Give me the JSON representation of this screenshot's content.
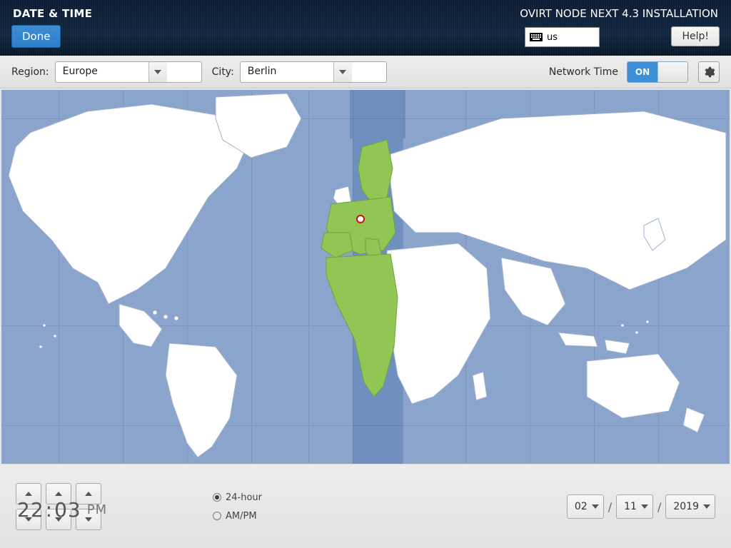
{
  "header": {
    "title": "DATE & TIME",
    "done_label": "Done",
    "installer_title": "OVIRT NODE NEXT 4.3 INSTALLATION",
    "keyboard_layout": "us",
    "help_label": "Help!"
  },
  "topbar": {
    "region_label": "Region:",
    "region_value": "Europe",
    "city_label": "City:",
    "city_value": "Berlin",
    "network_time_label": "Network Time",
    "network_time_on": "ON",
    "network_time_state": true
  },
  "map": {
    "selected_city": "Berlin",
    "selected_region": "Europe"
  },
  "time": {
    "hours": "22",
    "minutes": "03",
    "suffix": "PM",
    "format_24_label": "24-hour",
    "format_ampm_label": "AM/PM",
    "format_selected": "24-hour"
  },
  "date": {
    "day": "02",
    "month": "11",
    "year": "2019",
    "separator": "/"
  }
}
